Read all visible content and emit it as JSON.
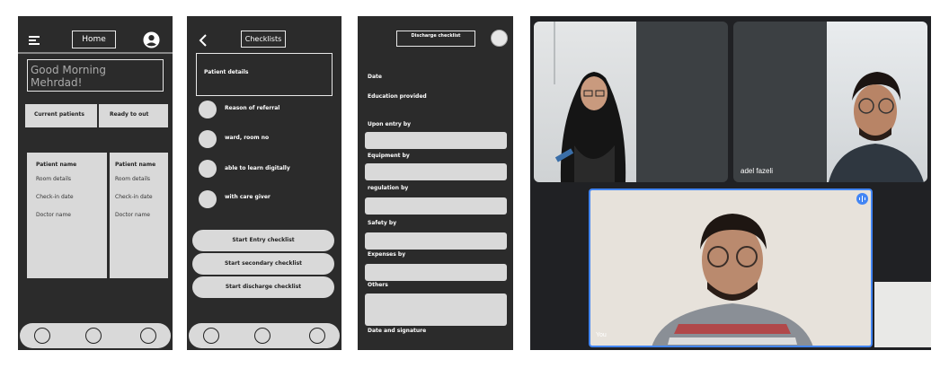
{
  "screen1": {
    "menu_icon": "hamburger-icon",
    "title": "Home",
    "profile_icon": "account-circle-icon",
    "greeting_line1": "Good Morning",
    "greeting_line2": "Mehrdad!",
    "tab_current": "Current patients",
    "tab_ready": "Ready to out",
    "card_left": [
      "Patient name",
      "Room details",
      "Check-in date",
      "Doctor name"
    ],
    "card_right": [
      "Patient name",
      "Room details",
      "Check-in date",
      "Doctor name"
    ]
  },
  "screen2": {
    "back_icon": "chevron-left-icon",
    "title": "Checklists",
    "patient_details": "Patient details",
    "options": [
      "Reason of referral",
      "ward, room no",
      "able to learn digitally",
      "with care giver"
    ],
    "buttons": [
      "Start Entry checklist",
      "Start secondary checklist",
      "Start discharge checklist"
    ]
  },
  "screen3": {
    "title": "Discharge checklist",
    "labels": [
      "Date",
      "Education provided",
      "Upon entry by",
      "Equipment by",
      "regulation by",
      "Safety by",
      "Expenses by",
      "Others",
      "Date and signature"
    ]
  },
  "video": {
    "participant2_name": "adel fazeli",
    "self_label": "You",
    "speaking_icon": "audio-level-icon",
    "accent": "#4285f4"
  }
}
